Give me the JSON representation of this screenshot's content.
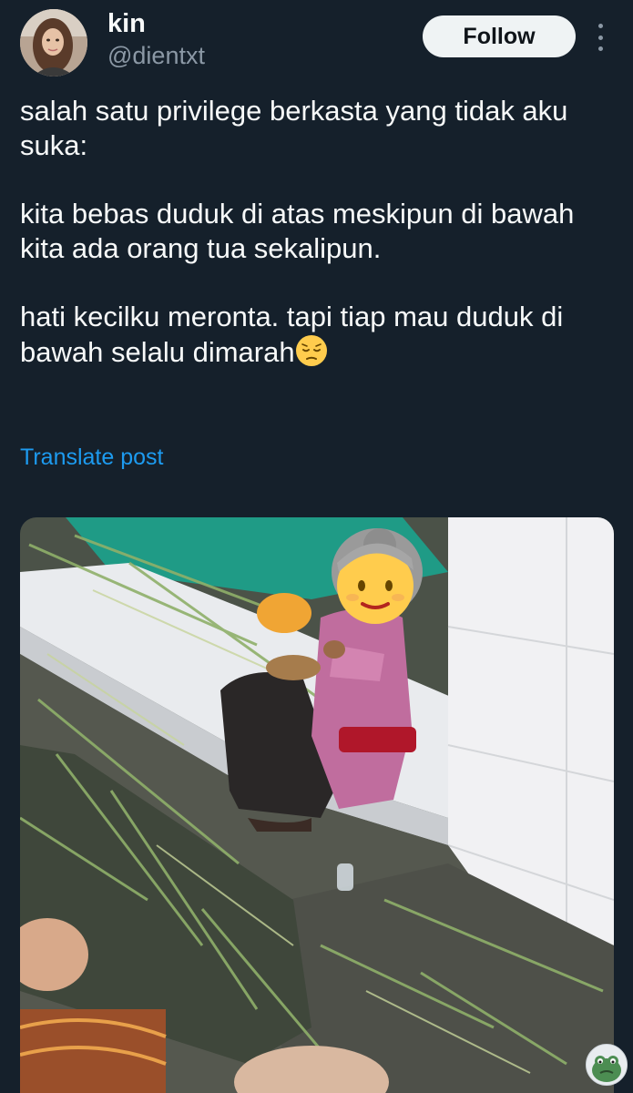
{
  "author": {
    "display_name": "kin",
    "handle": "@dientxt",
    "avatar_icon": "profile-photo"
  },
  "actions": {
    "follow_label": "Follow",
    "more_icon": "more-vertical-icon"
  },
  "tweet": {
    "paragraphs": [
      "salah satu privilege berkasta yang tidak aku suka:",
      "kita bebas duduk di atas meskipun di bawah kita ada orang tua sekalipun.",
      "hati kecilku meronta. tapi tiap mau duduk di bawah selalu dimarah"
    ],
    "trailing_emoji": "pensive-face-emoji",
    "translate_label": "Translate post"
  },
  "media": {
    "type": "photo",
    "overlay_emoji": "older-woman-emoji"
  },
  "colors": {
    "background": "#15202b",
    "text": "#f7f9f9",
    "secondary_text": "#8b98a5",
    "link": "#1d9bf0",
    "follow_bg": "#eff3f4"
  }
}
